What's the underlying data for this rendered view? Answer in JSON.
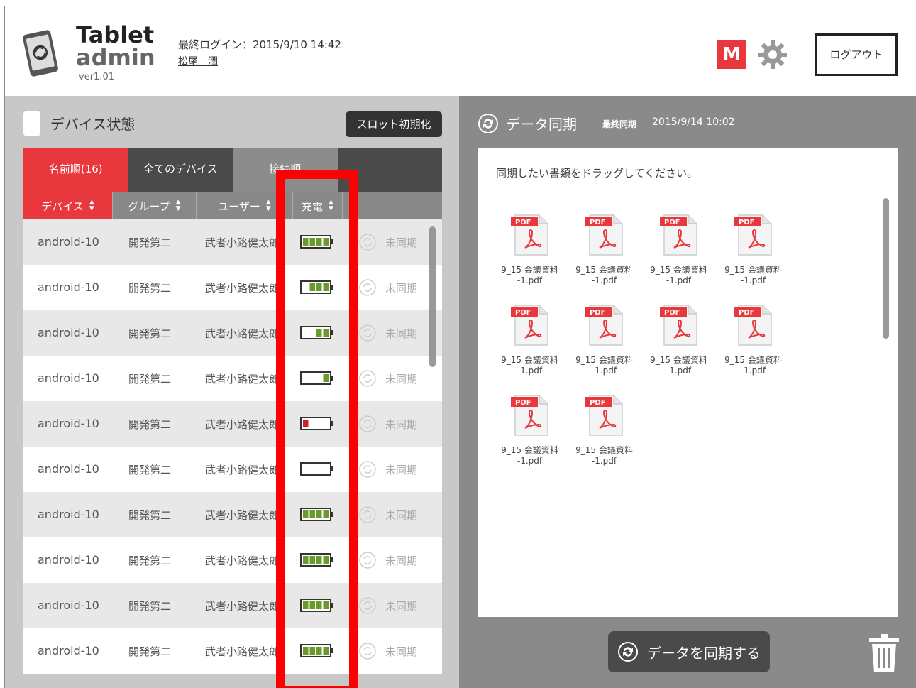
{
  "header": {
    "brand_line1": "Tablet",
    "brand_line2": "admin",
    "version": "ver1.01",
    "last_login": "最終ログイン：2015/9/10 14:42",
    "user_name": "松尾　潤",
    "m_badge": "M",
    "logout_label": "ログアウト"
  },
  "device_panel": {
    "title": "デバイス状態",
    "slot_reset_label": "スロット初期化",
    "tabs": [
      {
        "label": "名前順(16)"
      },
      {
        "label": "全てのデバイス"
      },
      {
        "label": "接続順"
      },
      {
        "label": ""
      }
    ],
    "columns": [
      {
        "label": "デバイス"
      },
      {
        "label": "グループ"
      },
      {
        "label": "ユーザー"
      },
      {
        "label": "充電"
      }
    ],
    "rows": [
      {
        "device": "android-10",
        "group": "開発第二",
        "user": "武者小路健太郎",
        "battery": 4,
        "status": "未同期"
      },
      {
        "device": "android-10",
        "group": "開発第二",
        "user": "武者小路健太郎",
        "battery": 3,
        "status": "未同期"
      },
      {
        "device": "android-10",
        "group": "開発第二",
        "user": "武者小路健太郎",
        "battery": 2,
        "status": "未同期"
      },
      {
        "device": "android-10",
        "group": "開発第二",
        "user": "武者小路健太郎",
        "battery": 1,
        "status": "未同期"
      },
      {
        "device": "android-10",
        "group": "開発第二",
        "user": "武者小路健太郎",
        "battery": 0,
        "status": "未同期"
      },
      {
        "device": "android-10",
        "group": "開発第二",
        "user": "武者小路健太郎",
        "battery": -1,
        "status": "未同期"
      },
      {
        "device": "android-10",
        "group": "開発第二",
        "user": "武者小路健太郎",
        "battery": 4,
        "status": "未同期"
      },
      {
        "device": "android-10",
        "group": "開発第二",
        "user": "武者小路健太郎",
        "battery": 4,
        "status": "未同期"
      },
      {
        "device": "android-10",
        "group": "開発第二",
        "user": "武者小路健太郎",
        "battery": 4,
        "status": "未同期"
      },
      {
        "device": "android-10",
        "group": "開発第二",
        "user": "武者小路健太郎",
        "battery": 4,
        "status": "未同期"
      }
    ]
  },
  "sync_panel": {
    "title": "データ同期",
    "last_sync_label": "最終同期",
    "last_sync_time": "2015/9/14 10:02",
    "drop_hint": "同期したい書類をドラッグしてください。",
    "pdf_badge": "PDF",
    "files": [
      {
        "name_line1": "9_15 会議資料",
        "name_line2": "-1.pdf"
      },
      {
        "name_line1": "9_15 会議資料",
        "name_line2": "-1.pdf"
      },
      {
        "name_line1": "9_15 会議資料",
        "name_line2": "-1.pdf"
      },
      {
        "name_line1": "9_15 会議資料",
        "name_line2": "-1.pdf"
      },
      {
        "name_line1": "9_15 会議資料",
        "name_line2": "-1.pdf"
      },
      {
        "name_line1": "9_15 会議資料",
        "name_line2": "-1.pdf"
      },
      {
        "name_line1": "9_15 会議資料",
        "name_line2": "-1.pdf"
      },
      {
        "name_line1": "9_15 会議資料",
        "name_line2": "-1.pdf"
      },
      {
        "name_line1": "9_15 会議資料",
        "name_line2": "-1.pdf"
      },
      {
        "name_line1": "9_15 会議資料",
        "name_line2": "-1.pdf"
      }
    ],
    "sync_button_label": "データを同期する"
  },
  "colors": {
    "accent": "#e8383d",
    "battery_green": "#6a9a2a",
    "battery_low": "#d0202a",
    "highlight": "#ff0000"
  }
}
